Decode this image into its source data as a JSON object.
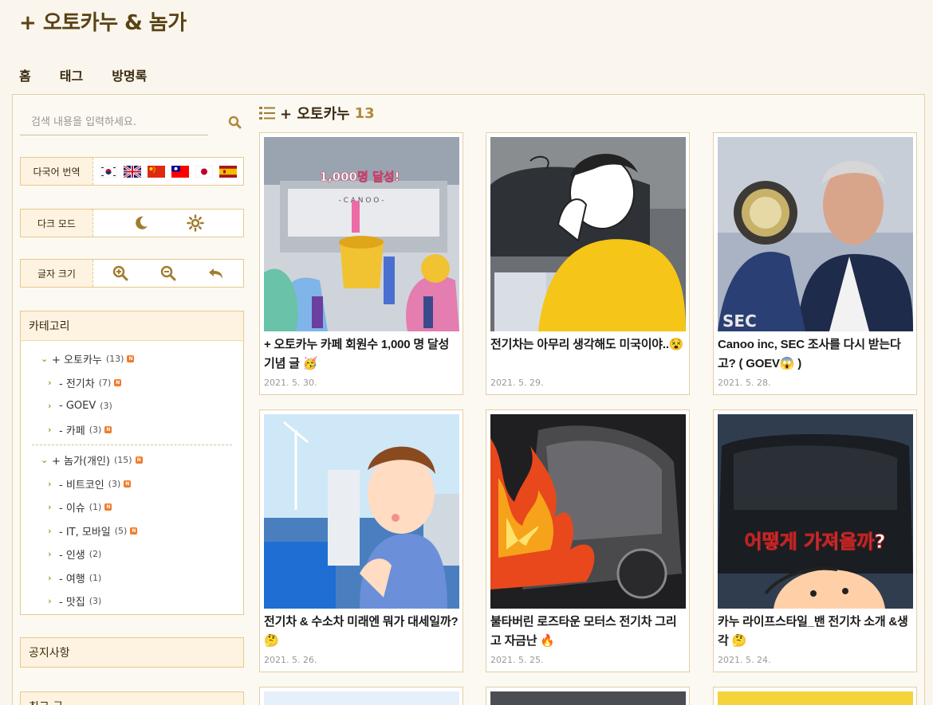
{
  "site": {
    "title": "+ 오토카누 & 놈가"
  },
  "nav": [
    {
      "label": "홈"
    },
    {
      "label": "태그"
    },
    {
      "label": "방명록"
    }
  ],
  "search": {
    "placeholder": "검색 내용을 입력하세요."
  },
  "translate": {
    "label": "다국어 번역",
    "flags": [
      "korea",
      "uk",
      "china",
      "taiwan",
      "japan",
      "spain"
    ]
  },
  "dark_mode": {
    "label": "다크 모드",
    "icons": [
      "moon-icon",
      "sun-icon"
    ]
  },
  "font_size": {
    "label": "글자 크기",
    "icons": [
      "zoom-in-icon",
      "zoom-out-icon",
      "undo-icon"
    ]
  },
  "category": {
    "title": "카테고리",
    "groups": [
      {
        "label": "+ 오토카누",
        "count": "(13)",
        "new": true,
        "items": [
          {
            "label": "- 전기차",
            "count": "(7)",
            "new": true
          },
          {
            "label": "- GOEV",
            "count": "(3)",
            "new": false
          },
          {
            "label": "- 카페",
            "count": "(3)",
            "new": true
          }
        ]
      },
      {
        "label": "+ 놈가(개인)",
        "count": "(15)",
        "new": true,
        "items": [
          {
            "label": "- 비트코인",
            "count": "(3)",
            "new": true
          },
          {
            "label": "- 이슈",
            "count": "(1)",
            "new": true
          },
          {
            "label": "- IT, 모바일",
            "count": "(5)",
            "new": true
          },
          {
            "label": "- 인생",
            "count": "(2)",
            "new": false
          },
          {
            "label": "- 여행",
            "count": "(1)",
            "new": false
          },
          {
            "label": "- 맛집",
            "count": "(3)",
            "new": false
          }
        ]
      }
    ]
  },
  "notice": {
    "title": "공지사항"
  },
  "recent": {
    "title": "최근 글"
  },
  "list": {
    "title": "+ 오토카누",
    "count": "13"
  },
  "posts": [
    {
      "title": "+ 오토카누 카페 회원수 1,000 명 달성 기념 글 🥳",
      "date": "2021. 5. 30.",
      "thumb_text": "1,000명 달성!"
    },
    {
      "title": "전기차는 아무리 생각해도 미국이야..😵",
      "date": "2021. 5. 29.",
      "thumb_text": ""
    },
    {
      "title": "Canoo inc, SEC 조사를 다시 받는다고? ( GOEV😱 )",
      "date": "2021. 5. 28.",
      "thumb_text": "SEC"
    },
    {
      "title": "전기차 & 수소차 미래엔 뭐가 대세일까? 🤔",
      "date": "2021. 5. 26.",
      "thumb_text": ""
    },
    {
      "title": "불타버린 로즈타운 모터스 전기차 그리고 자금난 🔥",
      "date": "2021. 5. 25.",
      "thumb_text": ""
    },
    {
      "title": "카누 라이프스타일_밴 전기차 소개 &생각 🤔",
      "date": "2021. 5. 24.",
      "thumb_text": "어떻게 가져올까?"
    }
  ]
}
